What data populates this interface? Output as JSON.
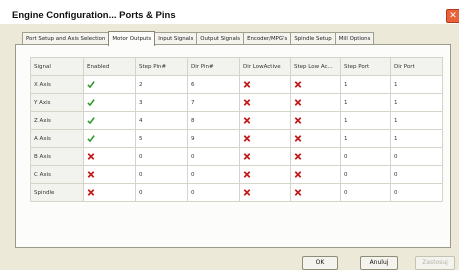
{
  "window": {
    "title": "Engine Configuration... Ports & Pins"
  },
  "tabs": [
    {
      "label": "Port Setup and Axis Selection",
      "active": false
    },
    {
      "label": "Motor Outputs",
      "active": true
    },
    {
      "label": "Input Signals",
      "active": false
    },
    {
      "label": "Output Signals",
      "active": false
    },
    {
      "label": "Encoder/MPG's",
      "active": false
    },
    {
      "label": "Spindle Setup",
      "active": false
    },
    {
      "label": "Mill Options",
      "active": false
    }
  ],
  "table": {
    "columns": [
      "Signal",
      "Enabled",
      "Step Pin#",
      "Dir Pin#",
      "Dir LowActive",
      "Step Low Ac...",
      "Step Port",
      "Dir Port"
    ],
    "rows": [
      {
        "signal": "X Axis",
        "enabled": "check-icon",
        "step_pin": "2",
        "dir_pin": "6",
        "dir_low_active": "x-icon",
        "step_low_active": "x-icon",
        "step_port": "1",
        "dir_port": "1"
      },
      {
        "signal": "Y Axis",
        "enabled": "check-icon",
        "step_pin": "3",
        "dir_pin": "7",
        "dir_low_active": "x-icon",
        "step_low_active": "x-icon",
        "step_port": "1",
        "dir_port": "1"
      },
      {
        "signal": "Z Axis",
        "enabled": "check-icon",
        "step_pin": "4",
        "dir_pin": "8",
        "dir_low_active": "x-icon",
        "step_low_active": "x-icon",
        "step_port": "1",
        "dir_port": "1"
      },
      {
        "signal": "A Axis",
        "enabled": "check-icon",
        "step_pin": "5",
        "dir_pin": "9",
        "dir_low_active": "x-icon",
        "step_low_active": "x-icon",
        "step_port": "1",
        "dir_port": "1"
      },
      {
        "signal": "B Axis",
        "enabled": "x-icon",
        "step_pin": "0",
        "dir_pin": "0",
        "dir_low_active": "x-icon",
        "step_low_active": "x-icon",
        "step_port": "0",
        "dir_port": "0"
      },
      {
        "signal": "C Axis",
        "enabled": "x-icon",
        "step_pin": "0",
        "dir_pin": "0",
        "dir_low_active": "x-icon",
        "step_low_active": "x-icon",
        "step_port": "0",
        "dir_port": "0"
      },
      {
        "signal": "Spindle",
        "enabled": "x-icon",
        "step_pin": "0",
        "dir_pin": "0",
        "dir_low_active": "x-icon",
        "step_low_active": "x-icon",
        "step_port": "0",
        "dir_port": "0"
      }
    ]
  },
  "buttons": {
    "ok": "OK",
    "cancel": "Anuluj",
    "apply": "Zastosuj"
  },
  "colors": {
    "check": "#2e9a2e",
    "x_mark": "#c11a1a",
    "close": "#e8623a"
  }
}
